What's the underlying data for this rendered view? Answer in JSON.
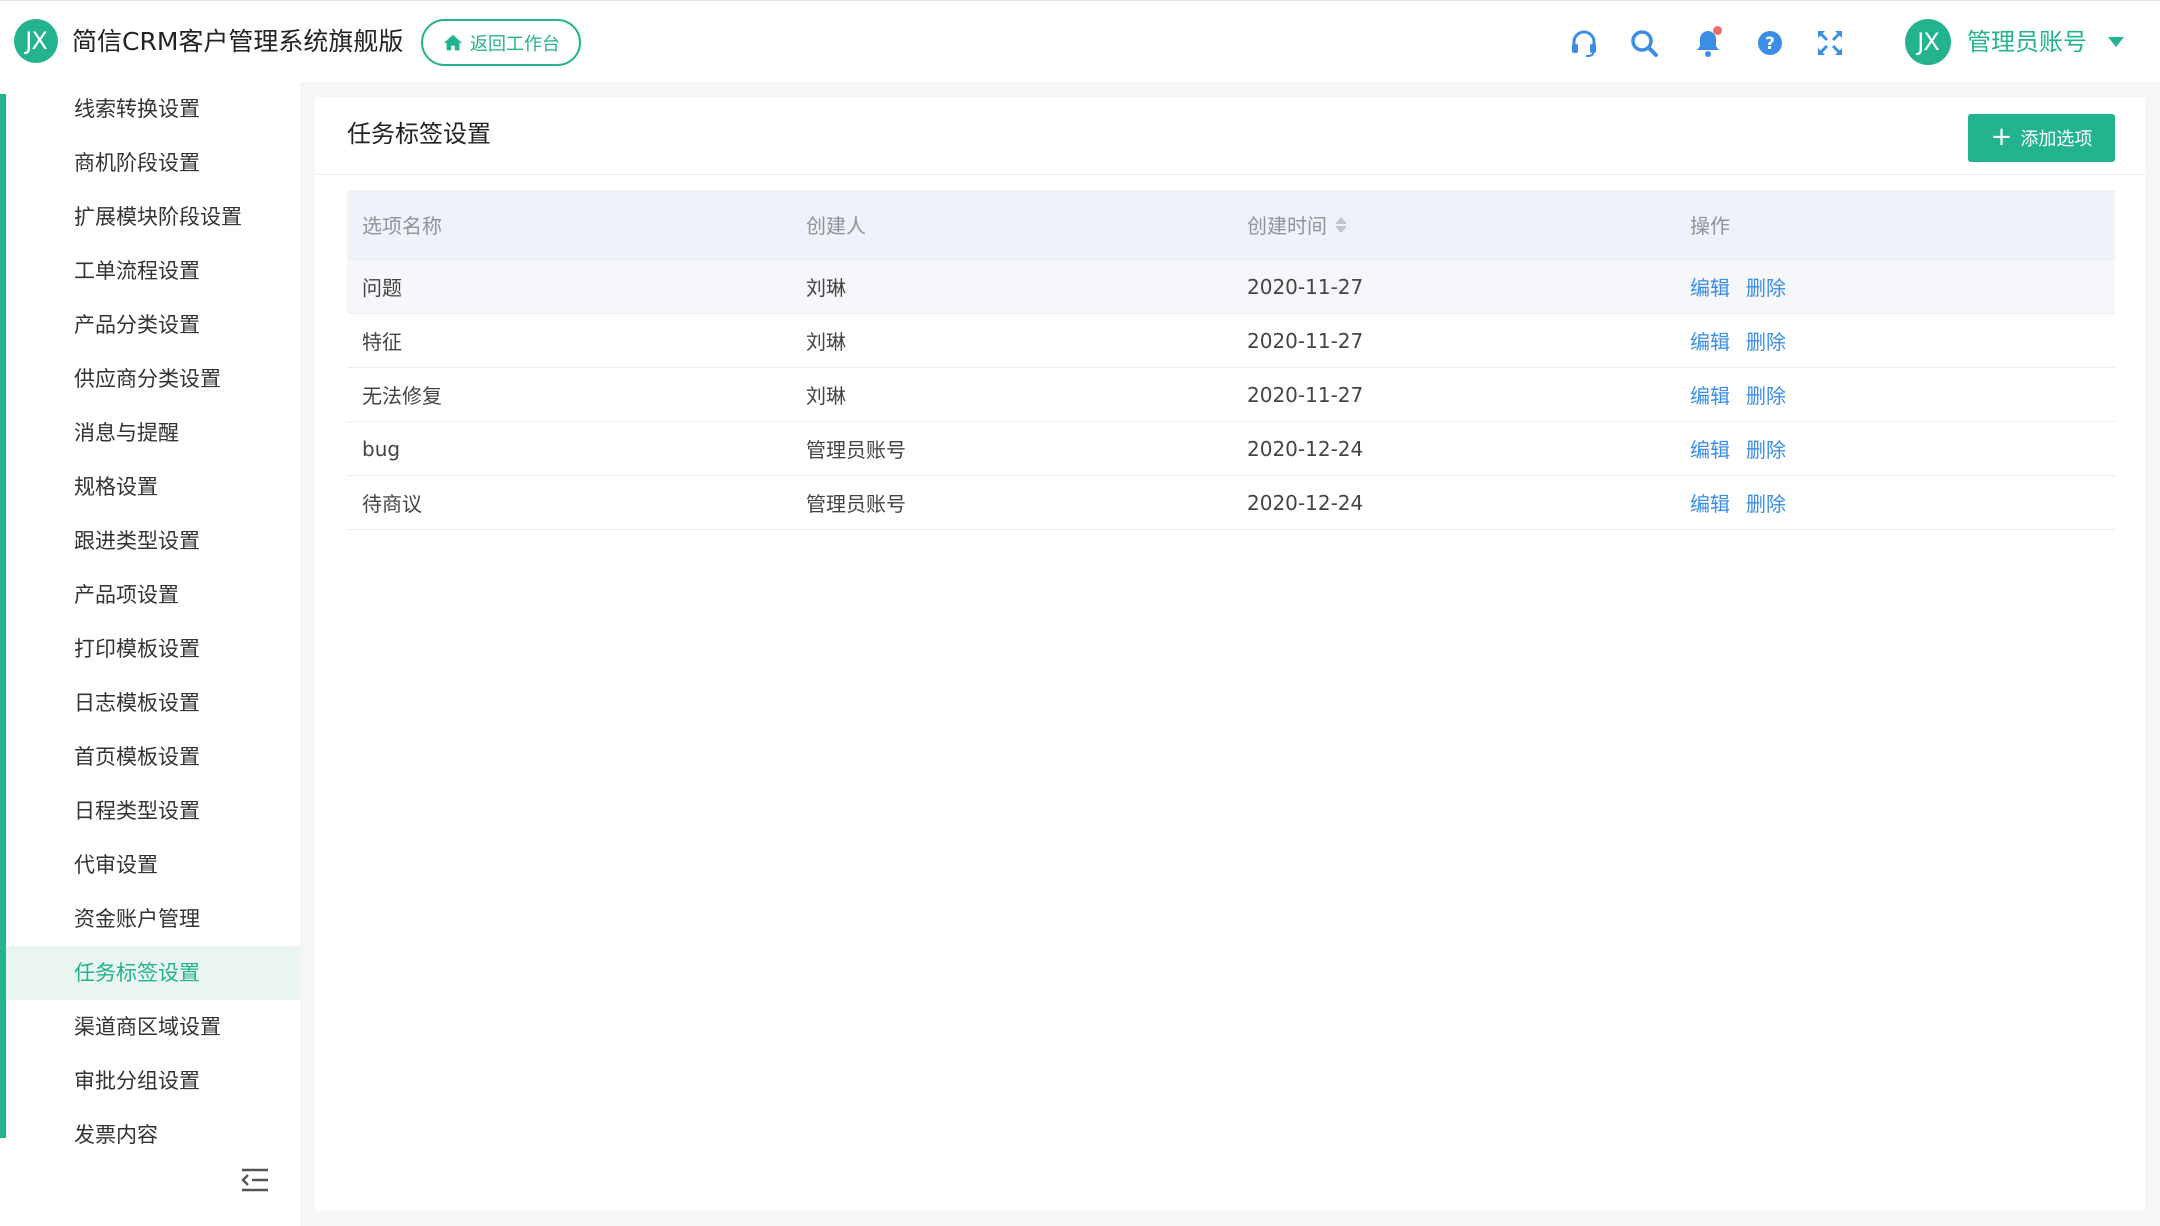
{
  "header": {
    "logo_text": "JX",
    "app_title": "简信CRM客户管理系统旗舰版",
    "back_button": "返回工作台",
    "icons": [
      "headset-icon",
      "search-icon",
      "bell-icon",
      "help-icon",
      "fullscreen-icon"
    ],
    "avatar_text": "JX",
    "user_name": "管理员账号"
  },
  "sidebar": {
    "items": [
      {
        "label": "线索转换设置"
      },
      {
        "label": "商机阶段设置"
      },
      {
        "label": "扩展模块阶段设置"
      },
      {
        "label": "工单流程设置"
      },
      {
        "label": "产品分类设置"
      },
      {
        "label": "供应商分类设置"
      },
      {
        "label": "消息与提醒"
      },
      {
        "label": "规格设置"
      },
      {
        "label": "跟进类型设置"
      },
      {
        "label": "产品项设置"
      },
      {
        "label": "打印模板设置"
      },
      {
        "label": "日志模板设置"
      },
      {
        "label": "首页模板设置"
      },
      {
        "label": "日程类型设置"
      },
      {
        "label": "代审设置"
      },
      {
        "label": "资金账户管理"
      },
      {
        "label": "任务标签设置",
        "active": true
      },
      {
        "label": "渠道商区域设置"
      },
      {
        "label": "审批分组设置"
      },
      {
        "label": "发票内容"
      }
    ]
  },
  "panel": {
    "title": "任务标签设置",
    "add_button": "添加选项",
    "columns": [
      "选项名称",
      "创建人",
      "创建时间",
      "操作"
    ],
    "rows": [
      {
        "name": "问题",
        "creator": "刘琳",
        "created": "2020-11-27"
      },
      {
        "name": "特征",
        "creator": "刘琳",
        "created": "2020-11-27"
      },
      {
        "name": "无法修复",
        "creator": "刘琳",
        "created": "2020-11-27"
      },
      {
        "name": "bug",
        "creator": "管理员账号",
        "created": "2020-12-24"
      },
      {
        "name": "待商议",
        "creator": "管理员账号",
        "created": "2020-12-24"
      }
    ],
    "actions": {
      "edit": "编辑",
      "delete": "删除"
    }
  },
  "colors": {
    "accent": "#24b38f",
    "link": "#3a8ee6",
    "badge": "#f56c6c"
  }
}
